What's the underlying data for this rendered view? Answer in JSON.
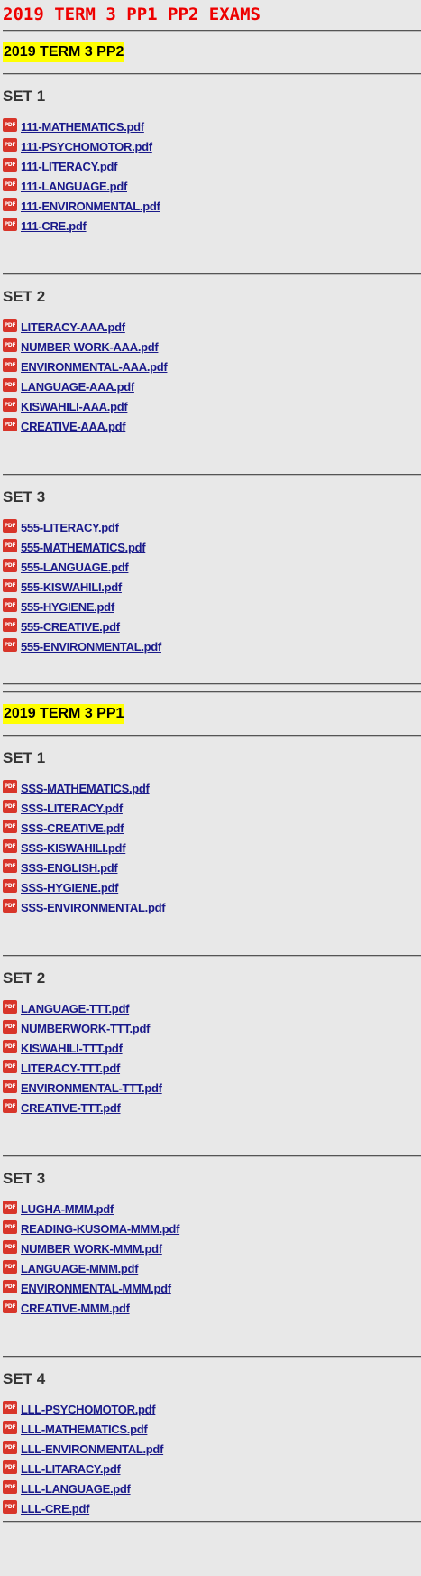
{
  "title": "2019 TERM 3 PP1 PP2 EXAMS",
  "pdf_icon_text": "PDF",
  "sections": [
    {
      "heading": "2019 TERM 3 PP2",
      "sets": [
        {
          "title": "SET 1",
          "files": [
            "111-MATHEMATICS.pdf",
            "111-PSYCHOMOTOR.pdf",
            "111-LITERACY.pdf",
            "111-LANGUAGE.pdf",
            "111-ENVIRONMENTAL.pdf",
            "111-CRE.pdf"
          ]
        },
        {
          "title": "SET 2",
          "files": [
            "LITERACY-AAA.pdf",
            "NUMBER WORK-AAA.pdf",
            "ENVIRONMENTAL-AAA.pdf",
            "LANGUAGE-AAA.pdf",
            "KISWAHILI-AAA.pdf",
            "CREATIVE-AAA.pdf"
          ]
        },
        {
          "title": "SET 3",
          "files": [
            "555-LITERACY.pdf",
            "555-MATHEMATICS.pdf",
            "555-LANGUAGE.pdf",
            "555-KISWAHILI.pdf",
            "555-HYGIENE.pdf",
            "555-CREATIVE.pdf",
            "555-ENVIRONMENTAL.pdf"
          ]
        }
      ]
    },
    {
      "heading": "2019 TERM 3 PP1",
      "sets": [
        {
          "title": "SET 1",
          "files": [
            "SSS-MATHEMATICS.pdf",
            "SSS-LITERACY.pdf",
            "SSS-CREATIVE.pdf",
            "SSS-KISWAHILI.pdf",
            "SSS-ENGLISH.pdf",
            "SSS-HYGIENE.pdf",
            "SSS-ENVIRONMENTAL.pdf"
          ]
        },
        {
          "title": "SET 2",
          "files": [
            "LANGUAGE-TTT.pdf",
            "NUMBERWORK-TTT.pdf",
            "KISWAHILI-TTT.pdf",
            "LITERACY-TTT.pdf",
            "ENVIRONMENTAL-TTT.pdf",
            "CREATIVE-TTT.pdf"
          ]
        },
        {
          "title": "SET 3",
          "files": [
            "LUGHA-MMM.pdf",
            "READING-KUSOMA-MMM.pdf",
            "NUMBER WORK-MMM.pdf",
            "LANGUAGE-MMM.pdf",
            "ENVIRONMENTAL-MMM.pdf",
            "CREATIVE-MMM.pdf"
          ]
        },
        {
          "title": "SET 4",
          "files": [
            "LLL-PSYCHOMOTOR.pdf",
            "LLL-MATHEMATICS.pdf",
            "LLL-ENVIRONMENTAL.pdf",
            "LLL-LITARACY.pdf",
            "LLL-LANGUAGE.pdf",
            "LLL-CRE.pdf"
          ]
        }
      ]
    }
  ],
  "colors": {
    "background": "#e8e8e8",
    "title": "#ee0000",
    "highlight": "#ffff00",
    "link": "#1a1a8a",
    "pdf_icon": "#d8352a"
  }
}
